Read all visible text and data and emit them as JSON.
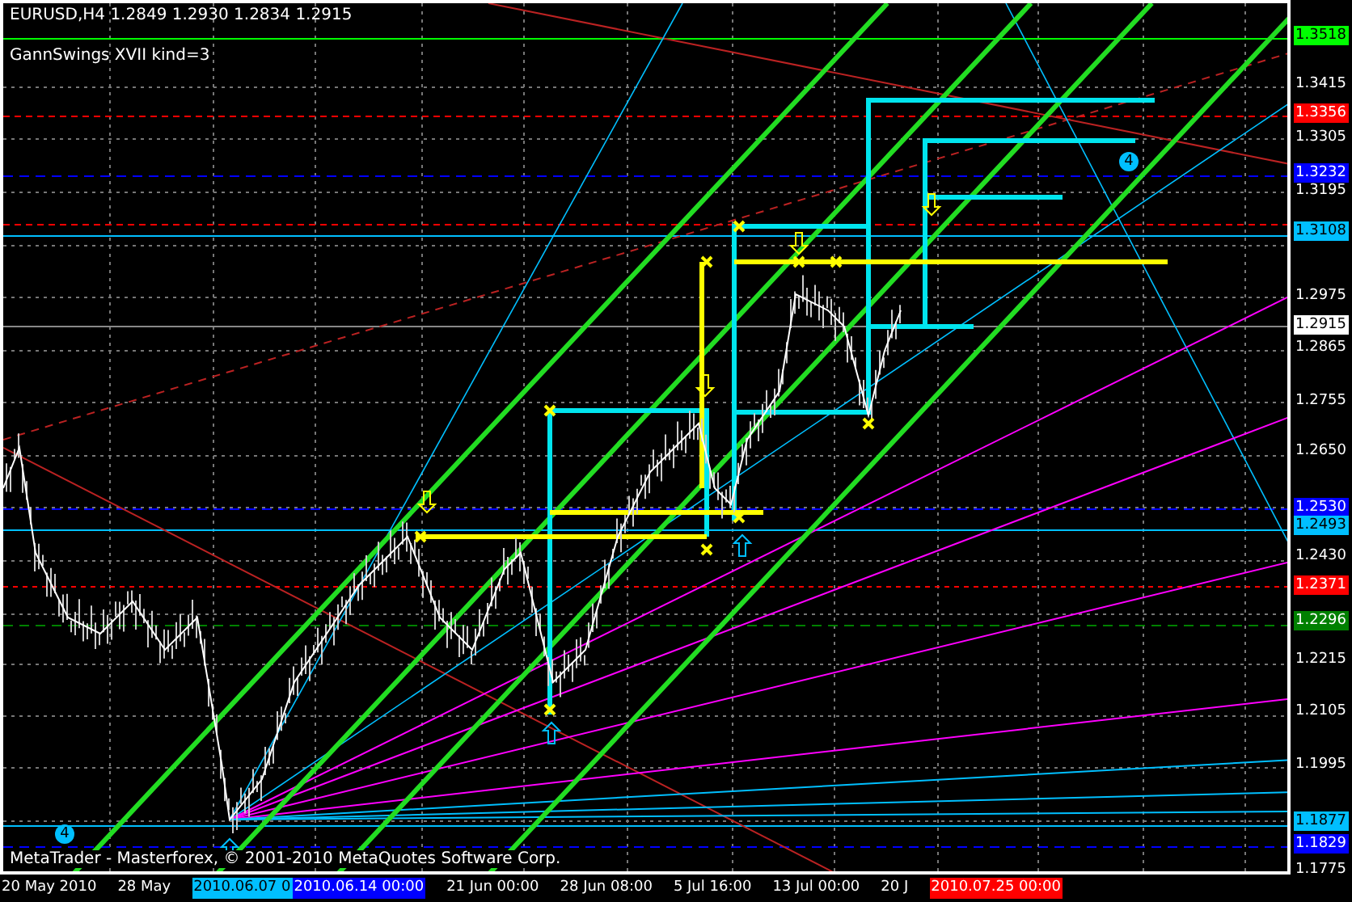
{
  "header": {
    "symbol_line": "EURUSD,H4  1.2849 1.2930 1.2834 1.2915",
    "indicator": "GannSwings XVII kind=3"
  },
  "wave_marks": [
    "4",
    "4"
  ],
  "footer": "MetaTrader - Masterforex, © 2001-2010 MetaQuotes Software Corp.",
  "price_axis": {
    "ticks": [
      "1.3415",
      "1.3305",
      "1.3195",
      "1.2975",
      "1.2865",
      "1.2755",
      "1.2650",
      "1.2430",
      "1.2215",
      "1.2105",
      "1.1995",
      "1.1775"
    ],
    "labels": [
      {
        "text": "1.3518",
        "color": "#00ff00"
      },
      {
        "text": "1.3356",
        "color": "#ff0000"
      },
      {
        "text": "1.3232",
        "color": "#0000ff"
      },
      {
        "text": "1.3108",
        "color": "#00bfff"
      },
      {
        "text": "1.2915",
        "color": "#ffffff"
      },
      {
        "text": "1.2530",
        "color": "#0000ff"
      },
      {
        "text": "1.2493",
        "color": "#00bfff"
      },
      {
        "text": "1.2371",
        "color": "#ff0000"
      },
      {
        "text": "1.2296",
        "color": "#008000"
      },
      {
        "text": "1.1877",
        "color": "#00bfff"
      },
      {
        "text": "1.1829",
        "color": "#0000ff"
      }
    ]
  },
  "time_axis": [
    {
      "text": "20 May 2010"
    },
    {
      "text": "28 May"
    },
    {
      "text": "2010.06.07 0",
      "color": "#00bfff"
    },
    {
      "text": "2010.06.14 00:00",
      "color": "#0000ff"
    },
    {
      "text": "21 Jun 00:00"
    },
    {
      "text": "28 Jun 08:00"
    },
    {
      "text": "5 Jul 16:00"
    },
    {
      "text": "13 Jul 00:00"
    },
    {
      "text": "20 J"
    },
    {
      "text": "2010.07.25 00:00",
      "color": "#ff0000"
    }
  ]
}
